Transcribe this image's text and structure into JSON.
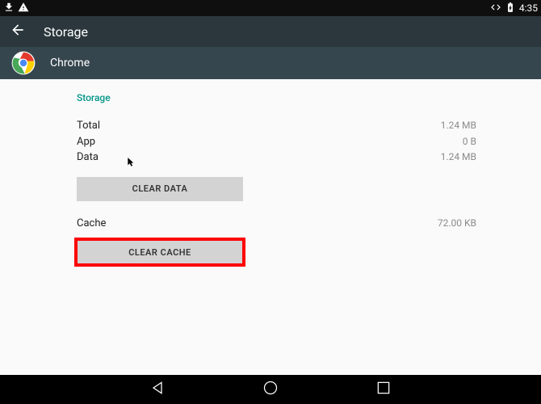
{
  "status": {
    "time": "4:35"
  },
  "action_bar": {
    "title": "Storage"
  },
  "app_bar": {
    "app_name": "Chrome"
  },
  "storage": {
    "section_title": "Storage",
    "rows": {
      "total_label": "Total",
      "total_value": "1.24 MB",
      "app_label": "App",
      "app_value": "0 B",
      "data_label": "Data",
      "data_value": "1.24 MB"
    },
    "clear_data_button": "CLEAR DATA"
  },
  "cache": {
    "label": "Cache",
    "value": "72.00 KB",
    "clear_cache_button": "CLEAR CACHE"
  }
}
